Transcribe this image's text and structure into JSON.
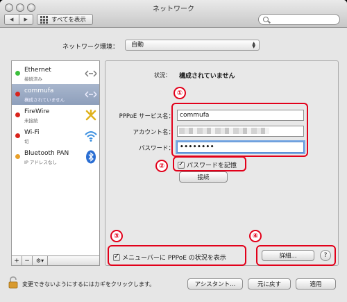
{
  "window": {
    "title": "ネットワーク"
  },
  "toolbar": {
    "back_label": "◀",
    "forward_label": "▶",
    "show_all_label": "すべてを表示",
    "search_placeholder": ""
  },
  "location": {
    "label": "ネットワーク環境：",
    "value": "自動"
  },
  "services": [
    {
      "name": "Ethernet",
      "status": "接続済み",
      "dot_color": "#3cbf3c",
      "icon": "ethernet-arrows-icon"
    },
    {
      "name": "commufa",
      "status": "構成されていません",
      "dot_color": "#d9241c",
      "icon": "ethernet-arrows-icon"
    },
    {
      "name": "FireWire",
      "status": "未接続",
      "dot_color": "#d9241c",
      "icon": "firewire-icon"
    },
    {
      "name": "Wi-Fi",
      "status": "切",
      "dot_color": "#d9241c",
      "icon": "wifi-icon"
    },
    {
      "name": "Bluetooth PAN",
      "status": "IP アドレスなし",
      "dot_color": "#e8a02a",
      "icon": "bluetooth-icon"
    }
  ],
  "sidebar_controls": {
    "add": "+",
    "remove": "−",
    "gear": "⚙▾"
  },
  "detail": {
    "status_label": "状況：",
    "status_value": "構成されていません",
    "service_name_label": "PPPoE サービス名：",
    "service_name_value": "commufa",
    "account_label": "アカウント名：",
    "account_value": "",
    "password_label": "パスワード：",
    "password_value": "••••••••",
    "remember_password_label": "パスワードを記憶",
    "connect_button": "接続",
    "show_in_menubar_label": "メニューバーに PPPoE の状況を表示",
    "advanced_button": "詳細...",
    "help_button": "?"
  },
  "annotations": [
    "①",
    "②",
    "③",
    "④"
  ],
  "footer": {
    "lock_text": "変更できないようにするにはカギをクリックします。",
    "assistant_button": "アシスタント...",
    "revert_button": "元に戻す",
    "apply_button": "適用"
  },
  "colors": {
    "annotation_red": "#e2001a",
    "selected_row": "#97a7c2"
  }
}
